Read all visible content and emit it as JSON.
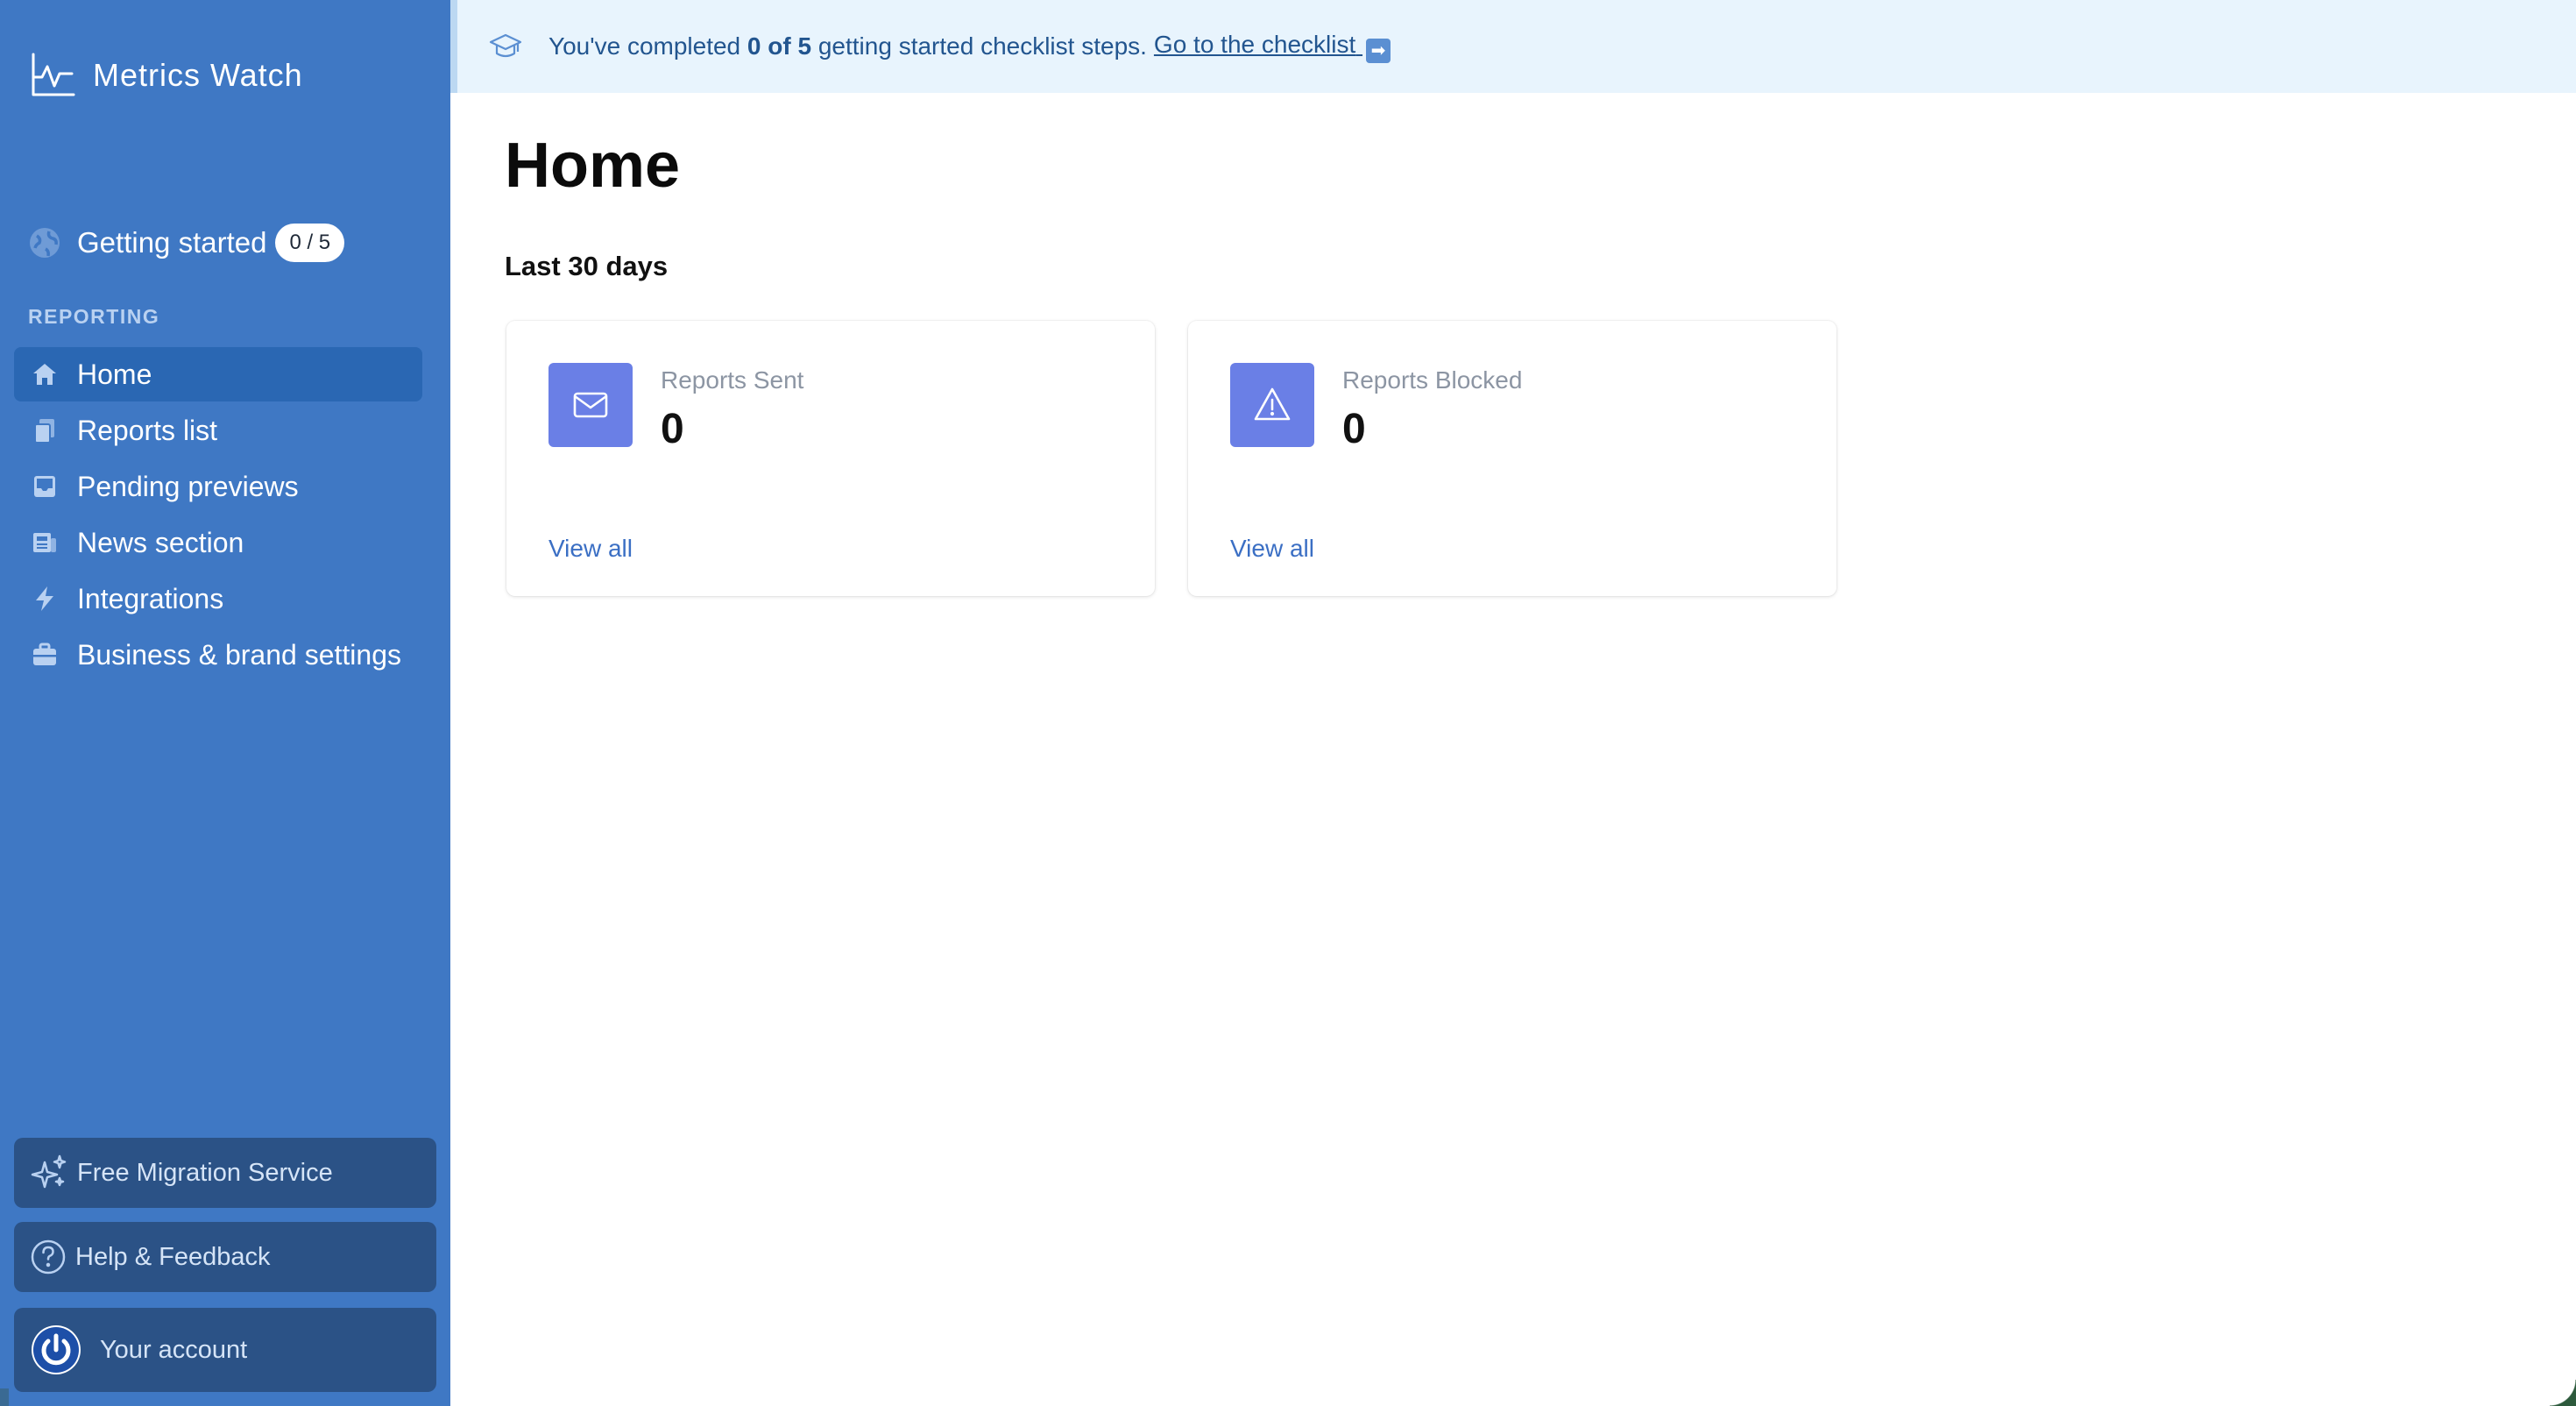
{
  "app": {
    "brand_name": "Metrics Watch",
    "accent_color": "#3f78c4",
    "icon_color": "#6a7fe6"
  },
  "sidebar": {
    "getting_started": {
      "label": "Getting started",
      "badge": "0 / 5",
      "icon": "globe-icon"
    },
    "section_heading": "REPORTING",
    "items": [
      {
        "label": "Home",
        "icon": "home-icon",
        "active": true
      },
      {
        "label": "Reports list",
        "icon": "documents-icon"
      },
      {
        "label": "Pending previews",
        "icon": "inbox-icon"
      },
      {
        "label": "News section",
        "icon": "newspaper-icon"
      },
      {
        "label": "Integrations",
        "icon": "lightning-icon"
      },
      {
        "label": "Business & brand settings",
        "icon": "briefcase-icon"
      }
    ],
    "migration_label": "Free Migration Service",
    "help_label": "Help & Feedback",
    "account_label": "Your account"
  },
  "banner": {
    "prefix": "You've completed",
    "progress": "0 of 5",
    "suffix": "getting started checklist steps.",
    "link_label": "Go to the checklist",
    "arrow_glyph": "➡"
  },
  "main": {
    "title": "Home",
    "period": "Last 30 days",
    "cards": [
      {
        "label": "Reports Sent",
        "value": "0",
        "link": "View all",
        "icon": "envelope-icon"
      },
      {
        "label": "Reports Blocked",
        "value": "0",
        "link": "View all",
        "icon": "warning-icon"
      }
    ]
  }
}
